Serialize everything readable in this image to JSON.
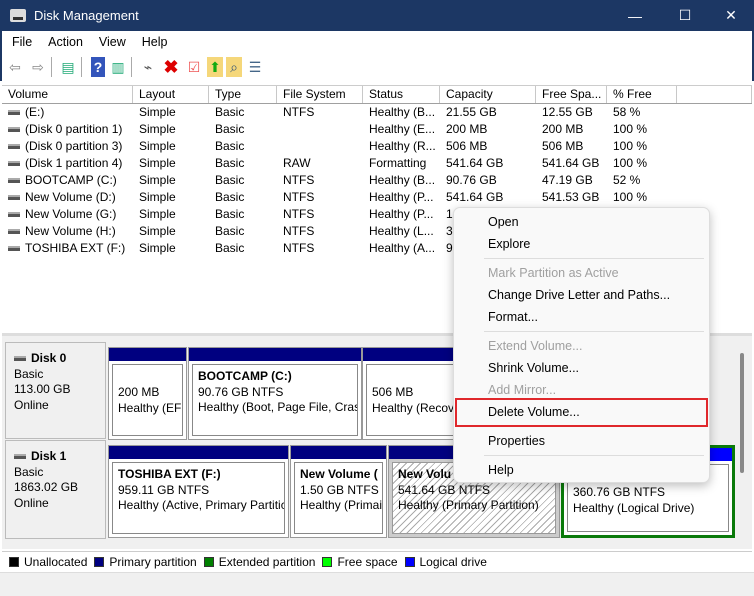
{
  "window": {
    "title": "Disk Management",
    "minimize": "—",
    "maximize": "☐",
    "close": "✕"
  },
  "menu": [
    "File",
    "Action",
    "View",
    "Help"
  ],
  "toolbar": [
    "back-icon",
    "forward-icon",
    "show-hide-console-tree-icon",
    "help-icon",
    "show-action-pane-icon",
    "connect-drive-icon",
    "delete-icon",
    "checklist-icon",
    "folder-up-icon",
    "folder-search-icon",
    "properties-list-icon"
  ],
  "table": {
    "columns": [
      "Volume",
      "Layout",
      "Type",
      "File System",
      "Status",
      "Capacity",
      "Free Spa...",
      "% Free"
    ],
    "rows": [
      [
        "(E:)",
        "Simple",
        "Basic",
        "NTFS",
        "Healthy (B...",
        "21.55 GB",
        "12.55 GB",
        "58 %"
      ],
      [
        "(Disk 0 partition 1)",
        "Simple",
        "Basic",
        "",
        "Healthy (E...",
        "200 MB",
        "200 MB",
        "100 %"
      ],
      [
        "(Disk 0 partition 3)",
        "Simple",
        "Basic",
        "",
        "Healthy (R...",
        "506 MB",
        "506 MB",
        "100 %"
      ],
      [
        "(Disk 1 partition 4)",
        "Simple",
        "Basic",
        "RAW",
        "Formatting",
        "541.64 GB",
        "541.64 GB",
        "100 %"
      ],
      [
        "BOOTCAMP (C:)",
        "Simple",
        "Basic",
        "NTFS",
        "Healthy (B...",
        "90.76 GB",
        "47.19 GB",
        "52 %"
      ],
      [
        "New Volume (D:)",
        "Simple",
        "Basic",
        "NTFS",
        "Healthy (P...",
        "541.64 GB",
        "541.53 GB",
        "100 %"
      ],
      [
        "New Volume (G:)",
        "Simple",
        "Basic",
        "NTFS",
        "Healthy (P...",
        "1",
        "",
        ""
      ],
      [
        "New Volume (H:)",
        "Simple",
        "Basic",
        "NTFS",
        "Healthy (L...",
        "3",
        "",
        ""
      ],
      [
        "TOSHIBA EXT (F:)",
        "Simple",
        "Basic",
        "NTFS",
        "Healthy (A...",
        "9",
        "",
        ""
      ]
    ]
  },
  "disks": [
    {
      "name": "Disk 0",
      "type": "Basic",
      "size": "113.00 GB",
      "status": "Online",
      "partitions": [
        {
          "title": "",
          "line1": "200 MB",
          "line2": "Healthy (EFI"
        },
        {
          "title": "BOOTCAMP  (C:)",
          "line1": "90.76 GB NTFS",
          "line2": "Healthy (Boot, Page File, Crash"
        },
        {
          "title": "",
          "line1": "506 MB",
          "line2": "Healthy (Recov"
        }
      ]
    },
    {
      "name": "Disk 1",
      "type": "Basic",
      "size": "1863.02 GB",
      "status": "Online",
      "partitions": [
        {
          "title": "TOSHIBA EXT  (F:)",
          "line1": "959.11 GB NTFS",
          "line2": "Healthy (Active, Primary Partitic"
        },
        {
          "title": "New Volume  (",
          "line1": "1.50 GB NTFS",
          "line2": "Healthy (Primai"
        },
        {
          "title": "New Volu",
          "line1": "541.64 GB NTFS",
          "line2": "Healthy (Primary Partition)"
        },
        {
          "title": "",
          "line1": "360.76 GB NTFS",
          "line2": "Healthy (Logical Drive)"
        }
      ]
    }
  ],
  "legend": [
    {
      "label": "Unallocated",
      "color": "#000000"
    },
    {
      "label": "Primary partition",
      "color": "#000080"
    },
    {
      "label": "Extended partition",
      "color": "#008000"
    },
    {
      "label": "Free space",
      "color": "#00ff00"
    },
    {
      "label": "Logical drive",
      "color": "#0000ff"
    }
  ],
  "context_menu": {
    "open": "Open",
    "explore": "Explore",
    "mark_active": "Mark Partition as Active",
    "change_letter": "Change Drive Letter and Paths...",
    "format": "Format...",
    "extend": "Extend Volume...",
    "shrink": "Shrink Volume...",
    "add_mirror": "Add Mirror...",
    "delete": "Delete Volume...",
    "properties": "Properties",
    "help": "Help",
    "highlight_color": "#e0282c"
  }
}
